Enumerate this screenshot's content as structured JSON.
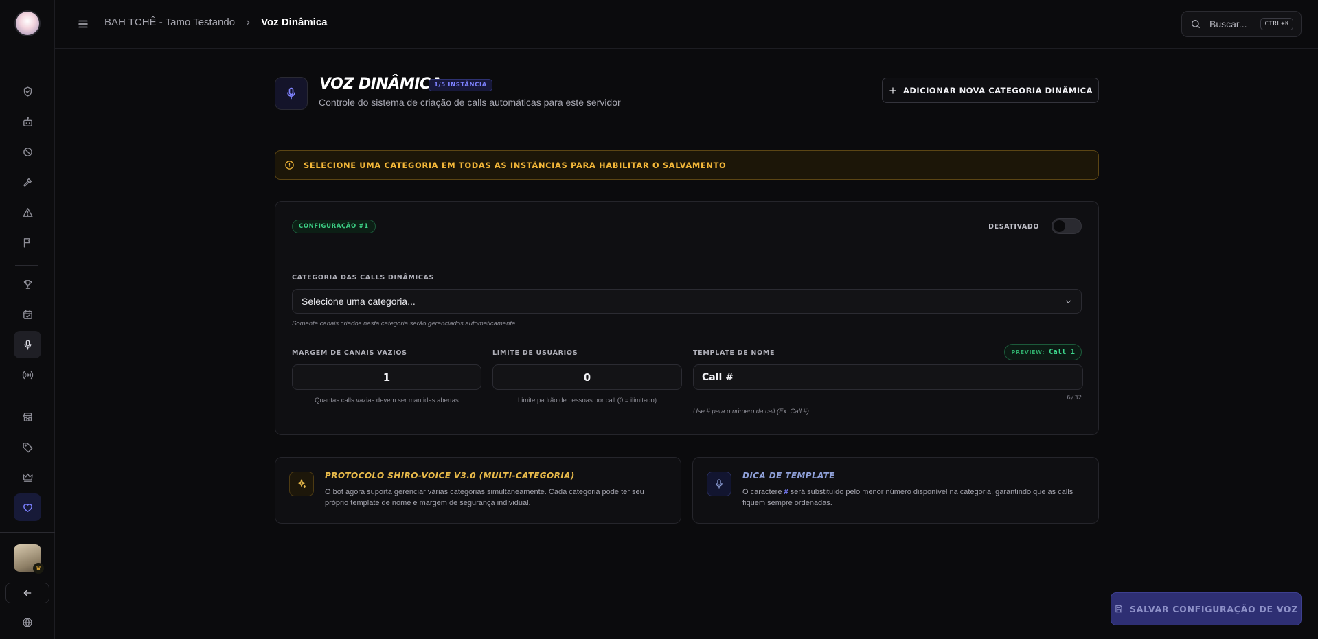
{
  "breadcrumb": {
    "server": "BAH TCHÊ - Tamo Testando",
    "current": "Voz Dinâmica"
  },
  "search": {
    "placeholder": "Buscar...",
    "shortcut": "CTRL+K"
  },
  "header": {
    "title": "VOZ DINÂMICA",
    "badge": "1/5 INSTÂNCIA",
    "subtitle": "Controle do sistema de criação de calls automáticas para este servidor",
    "add_button": "ADICIONAR NOVA CATEGORIA DINÂMICA"
  },
  "alert": {
    "text": "SELECIONE UMA CATEGORIA EM TODAS AS INSTÂNCIAS PARA HABILITAR O SALVAMENTO"
  },
  "config": {
    "badge": "CONFIGURAÇÃO #1",
    "toggle_label": "DESATIVADO",
    "enabled": false,
    "category_label": "CATEGORIA DAS CALLS DINÂMICAS",
    "category_value": "Selecione uma categoria...",
    "category_hint": "Somente canais criados nesta categoria serão gerenciados automaticamente.",
    "margin_label": "MARGEM DE CANAIS VAZIOS",
    "margin_value": "1",
    "margin_hint": "Quantas calls vazias devem ser mantidas abertas",
    "limit_label": "LIMITE DE USUÁRIOS",
    "limit_value": "0",
    "limit_hint": "Limite padrão de pessoas por call (0 = ilimitado)",
    "template_label": "TEMPLATE DE NOME",
    "preview_label": "PREVIEW:",
    "preview_value": "Call 1",
    "template_value": "Call #",
    "template_counter": "6/32",
    "template_hint": "Use # para o número da call (Ex: Call #)"
  },
  "info_protocol": {
    "title": "PROTOCOLO SHIRO-VOICE V3.0 (MULTI-CATEGORIA)",
    "text": "O bot agora suporta gerenciar várias categorias simultaneamente. Cada categoria pode ter seu próprio template de nome e margem de segurança individual."
  },
  "info_tip": {
    "title": "DICA DE TEMPLATE",
    "text_before": "O caractere ",
    "hash": "#",
    "text_after": " será substituído pelo menor número disponível na categoria, garantindo que as calls fiquem sempre ordenadas."
  },
  "save_button": "SALVAR CONFIGURAÇÃO DE VOZ",
  "colors": {
    "accent": "#7b80ff",
    "warning": "#f3b739",
    "success": "#3ccf84",
    "protocol": "#e7b94a",
    "tip": "#8fa0d8"
  },
  "sidebar_icons": [
    "shield-check-icon",
    "bot-icon",
    "ban-icon",
    "hammer-icon",
    "alert-triangle-icon",
    "flag-icon",
    "trophy-icon",
    "calendar-check-icon",
    "mic-icon",
    "radio-icon",
    "store-icon",
    "tag-icon",
    "crown-icon",
    "heart-icon"
  ]
}
